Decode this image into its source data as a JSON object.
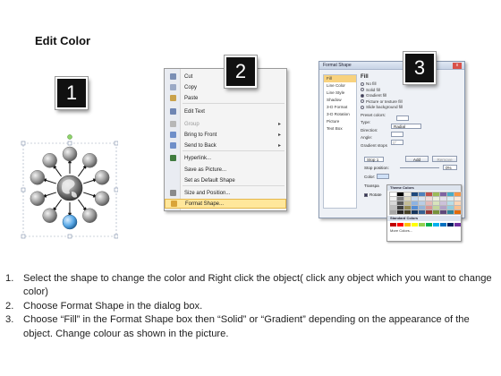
{
  "page": {
    "title": "Edit Color"
  },
  "badges": [
    "1",
    "2",
    "3"
  ],
  "context_menu": {
    "items": [
      {
        "label": "Cut",
        "icon": "scissors-icon",
        "color": "#7a8fb5",
        "disabled": false,
        "submenu": false
      },
      {
        "label": "Copy",
        "icon": "copy-icon",
        "color": "#9aa9c6",
        "disabled": false,
        "submenu": false
      },
      {
        "label": "Paste",
        "icon": "paste-icon",
        "color": "#c9a24c",
        "disabled": false,
        "submenu": false
      },
      {
        "label": "Edit Text",
        "icon": "edit-text-icon",
        "color": "#6f86b3",
        "disabled": false,
        "submenu": false
      },
      {
        "label": "Group",
        "icon": "group-icon",
        "color": "#b7b7b7",
        "disabled": true,
        "submenu": true
      },
      {
        "label": "Bring to Front",
        "icon": "bring-front-icon",
        "color": "#6f8fc9",
        "disabled": false,
        "submenu": true
      },
      {
        "label": "Send to Back",
        "icon": "send-back-icon",
        "color": "#6f8fc9",
        "disabled": false,
        "submenu": true
      },
      {
        "label": "Hyperlink...",
        "icon": "hyperlink-icon",
        "color": "#3f7b3f",
        "disabled": false,
        "submenu": false
      },
      {
        "label": "Save as Picture...",
        "icon": "",
        "color": "",
        "disabled": false,
        "submenu": false
      },
      {
        "label": "Set as Default Shape",
        "icon": "",
        "color": "",
        "disabled": false,
        "submenu": false
      },
      {
        "label": "Size and Position...",
        "icon": "size-position-icon",
        "color": "#8a8a8a",
        "disabled": false,
        "submenu": false
      },
      {
        "label": "Format Shape...",
        "icon": "format-shape-icon",
        "color": "#d9a43a",
        "disabled": false,
        "submenu": false,
        "highlighted": true
      }
    ]
  },
  "format_dialog": {
    "title": "Format Shape",
    "close": "x",
    "categories": [
      "Fill",
      "Line Color",
      "Line Style",
      "Shadow",
      "3-D Format",
      "3-D Rotation",
      "Picture",
      "Text Box"
    ],
    "fill": {
      "heading": "Fill",
      "options": [
        "No fill",
        "Solid fill",
        "Gradient fill",
        "Picture or texture fill",
        "Slide background fill"
      ],
      "selected": "Gradient fill",
      "preset_colors": "Preset colors:",
      "type_label": "Type:",
      "type_value": "Radial",
      "direction_label": "Direction:",
      "angle_label": "Angle:",
      "angle_value": "0°",
      "gradient_stops": "Gradient stops",
      "stop_value": "Stop 1",
      "add_button": "Add",
      "remove_button": "Remove",
      "stop_position": "Stop position:",
      "stop_position_value": "0%",
      "color_label": "Color:",
      "transparency_label": "Transpa",
      "rotate_label": "Rotate"
    },
    "palette": {
      "theme_colors": "Theme Colors",
      "standard_colors": "Standard Colors",
      "more_colors": "More Colors...",
      "theme": [
        "#ffffff",
        "#000000",
        "#eeece1",
        "#1f497d",
        "#4f81bd",
        "#c0504d",
        "#9bbb59",
        "#8064a2",
        "#4bacc6",
        "#f79646",
        "#f2f2f2",
        "#7f7f7f",
        "#ddd9c3",
        "#c6d9f0",
        "#dbe5f1",
        "#f2dcdb",
        "#ebf1dd",
        "#e5e0ec",
        "#dbeef3",
        "#fdeada",
        "#d8d8d8",
        "#595959",
        "#c4bd97",
        "#8db3e2",
        "#b8cce4",
        "#e5b9b7",
        "#d7e3bc",
        "#ccc1d9",
        "#b7dde8",
        "#fbd5b5",
        "#bfbfbf",
        "#3f3f3f",
        "#938953",
        "#548dd4",
        "#95b3d7",
        "#d99694",
        "#c3d69b",
        "#b2a2c7",
        "#92cddc",
        "#fac08f",
        "#a5a5a5",
        "#262626",
        "#494429",
        "#17365d",
        "#366092",
        "#953734",
        "#76923c",
        "#5f497a",
        "#31859b",
        "#e36c09"
      ],
      "standard": [
        "#c00000",
        "#ff0000",
        "#ffc000",
        "#ffff00",
        "#92d050",
        "#00b050",
        "#00b0f0",
        "#0070c0",
        "#002060",
        "#7030a0"
      ]
    }
  },
  "steps": [
    {
      "num": "1.",
      "text": "Select the shape to change the color and Right click the object( click any object which you want to change color)"
    },
    {
      "num": "2.",
      "text": "Choose Format Shape in the dialog box."
    },
    {
      "num": "3.",
      "text": "Choose “Fill” in the Format Shape box then “Solid” or “Gradient” depending on the appearance of the object. Change colour as shown in the picture."
    }
  ]
}
